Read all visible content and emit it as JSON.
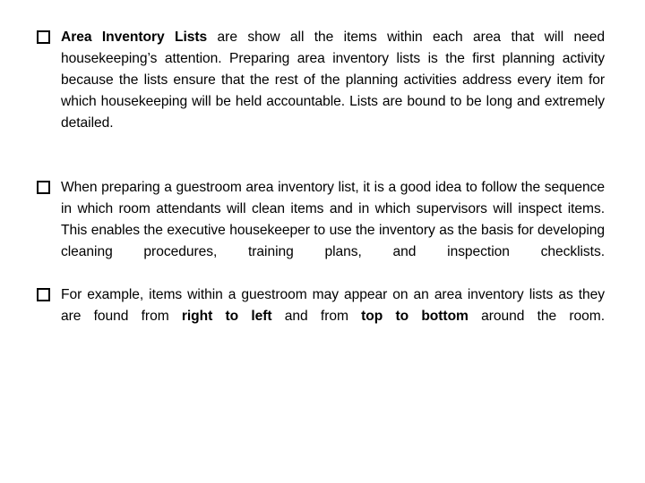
{
  "slide": {
    "background_color": "#ffffff",
    "text_color": "#000000",
    "bullet_glyph": "❑",
    "bullet_icon_name": "hollow-square-bullet-icon"
  },
  "bullets": [
    {
      "id": "area-inventory-lists",
      "marker": "❑",
      "segments": [
        {
          "text": "Area Inventory Lists",
          "bold": true
        },
        {
          "text": " are show all the items within each area that will need housekeeping’s attention. Preparing area inventory lists is the first planning activity because the lists ensure that the rest of the planning activities address every item for which housekeeping will be held accountable. Lists are bound to be long and extremely detailed.",
          "bold": false
        }
      ],
      "plain_text": "Area Inventory Lists are show all the items within each area that will need housekeeping’s attention. Preparing area inventory lists is the first planning activity because the lists ensure that the rest of the planning activities address every item for which housekeeping will be held accountable. Lists are bound to be long and extremely detailed."
    },
    {
      "id": "guestroom-area-inventory-sequence",
      "marker": "❑",
      "segments": [
        {
          "text": "When preparing a guestroom area inventory list, it is a good idea to follow the sequence in which room attendants will clean items and in which supervisors will inspect items. This enables the executive housekeeper to use the inventory as the basis for developing cleaning procedures, training plans, and inspection checklists.",
          "bold": false
        }
      ],
      "plain_text": "When preparing a guestroom area inventory list, it is a good idea to follow the sequence in which room attendants will clean items and in which supervisors will inspect items. This enables the executive housekeeper to use the inventory as the basis for developing cleaning procedures, training plans, and inspection checklists."
    },
    {
      "id": "guestroom-example-order",
      "marker": "❑",
      "segments": [
        {
          "text": "For example, items within a guestroom may appear on an area inventory lists as they are found from ",
          "bold": false
        },
        {
          "text": "right to left",
          "bold": true
        },
        {
          "text": " and from ",
          "bold": false
        },
        {
          "text": "top to bottom",
          "bold": true
        },
        {
          "text": " around the room.",
          "bold": false
        }
      ],
      "plain_text": "For example, items within a guestroom may appear on an area inventory lists as they are found from right to left and from top to bottom around the room."
    }
  ]
}
